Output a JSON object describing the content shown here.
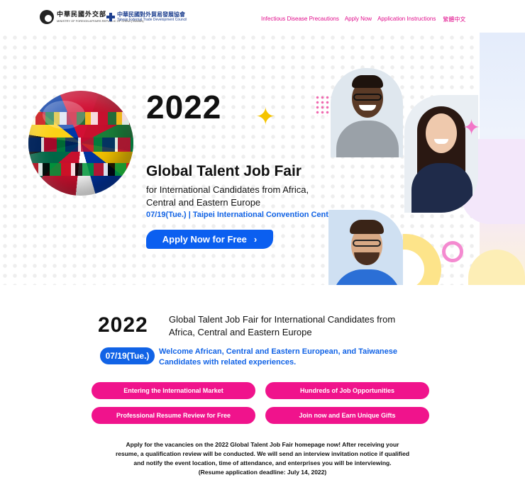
{
  "header": {
    "logo_mofa_zh": "中華民國外交部",
    "logo_mofa_en": "MINISTRY OF FOREIGN AFFAIRS REPUBLIC OF CHINA (TAIWAN)",
    "logo_taitra_zh": "中華民國對外貿易發展協會",
    "logo_taitra_en": "Taiwan External Trade Development Council",
    "nav": {
      "precautions": "Infectious Disease Precautions",
      "apply": "Apply Now",
      "instructions": "Application Instructions",
      "language": "繁體中文"
    }
  },
  "hero": {
    "year": "2022",
    "title": "Global Talent Job Fair",
    "subtitle_line1": "for International Candidates from Africa,",
    "subtitle_line2": "Central and Eastern Europe",
    "date_venue": "07/19(Tue.) | Taipei International Convention Center",
    "apply_button": "Apply Now for Free",
    "apply_chevron": "›"
  },
  "section": {
    "year": "2022",
    "title_line1": "Global Talent Job Fair for International Candidates from",
    "title_line2": "Africa, Central and Eastern Europe",
    "date_pill": "07/19(Tue.)",
    "welcome_line1": "Welcome African, Central and Eastern European, and Taiwanese",
    "welcome_line2": "Candidates with related experiences.",
    "features": [
      "Entering the International Market",
      "Hundreds of Job Opportunities",
      "Professional Resume Review for Free",
      "Join now and Earn Unique Gifts"
    ],
    "description_line1": "Apply for the vacancies on the 2022 Global Talent Job Fair homepage now! After receiving your",
    "description_line2": "resume, a qualification review will be conducted. We will send an interview invitation notice if qualified",
    "description_line3": "and notify the event location, time of attendance, and enterprises you will be interviewing.",
    "description_line4": "(Resume application deadline: July 14, 2022)"
  },
  "colors": {
    "nav_pink": "#e10d8c",
    "feature_pink": "#f0138c",
    "accent_blue": "#1163e6",
    "button_blue": "#0b5ff0"
  }
}
